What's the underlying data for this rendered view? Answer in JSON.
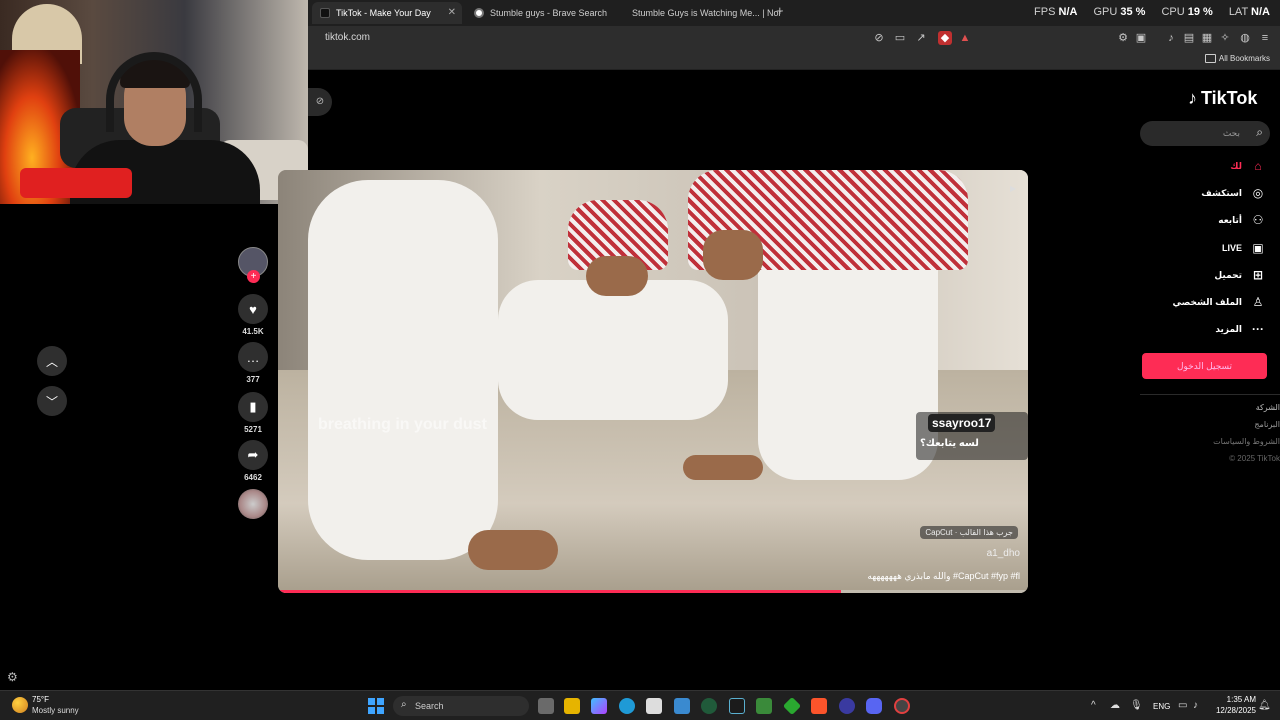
{
  "browser": {
    "tabs": [
      {
        "title": "TikTok - Make Your Day",
        "active": true
      },
      {
        "title": "Stumble guys - Brave Search",
        "active": false
      },
      {
        "title": "Stumble Guys is Watching Me... | Nor",
        "active": false
      }
    ],
    "new_tab": "+",
    "url": "tiktok.com",
    "bookmarks_label": "All Bookmarks",
    "stats": [
      {
        "label": "FPS",
        "value": "N/A"
      },
      {
        "label": "GPU",
        "value": "35 %"
      },
      {
        "label": "CPU",
        "value": "19 %"
      },
      {
        "label": "LAT",
        "value": "N/A"
      }
    ]
  },
  "tiktok": {
    "logo": "TikTok",
    "search_placeholder": "بحث",
    "nav": [
      {
        "label": "لك",
        "icon": "home-icon",
        "active": true
      },
      {
        "label": "استكشف",
        "icon": "compass-icon",
        "active": false
      },
      {
        "label": "أتابعه",
        "icon": "user-plus-icon",
        "active": false
      },
      {
        "label": "LIVE",
        "icon": "live-icon",
        "active": false
      },
      {
        "label": "تحميل",
        "icon": "upload-icon",
        "active": false
      },
      {
        "label": "الملف الشخصي",
        "icon": "profile-icon",
        "active": false
      },
      {
        "label": "المزيد",
        "icon": "more-icon",
        "active": false
      }
    ],
    "login_button": "تسجيل الدخول",
    "footer": [
      "الشركة",
      "البرنامج",
      "الشروط والسياسات",
      "© 2025 TikTok"
    ],
    "actions": {
      "likes": "41.5K",
      "comments": "377",
      "saves": "5271",
      "shares": "6462"
    },
    "video": {
      "caption_overlay": "breathing in your dust",
      "comment_user": "ssayroo17",
      "comment_text": "لسه يتابعك؟",
      "capcut_badge": "CapCut · جرب هذا القالب",
      "author": "a1_dho",
      "description": "والله مابذري هههههههه #CapCut #fyp #fl",
      "progress": 0.75
    }
  },
  "taskbar": {
    "weather_temp": "75°F",
    "weather_desc": "Mostly sunny",
    "search_label": "Search",
    "language": "ENG",
    "time": "1:35 AM",
    "date": "12/28/2025"
  },
  "colors": {
    "accent": "#fe2c55",
    "chrome_dark": "#1f1f1f",
    "chrome_mid": "#2d2d2d",
    "taskbar": "#202020"
  }
}
